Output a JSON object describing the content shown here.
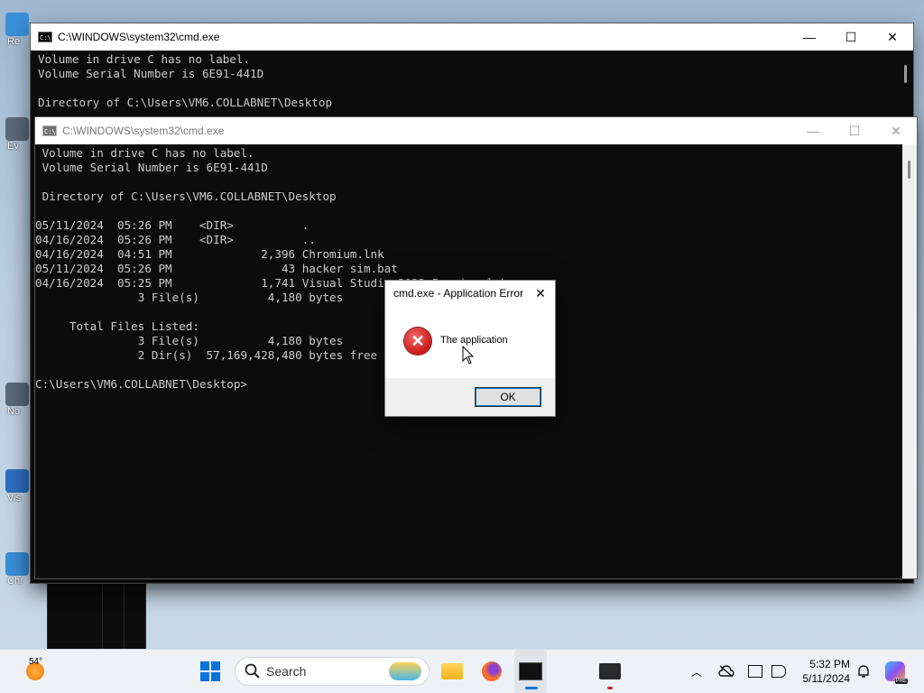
{
  "desktop": {
    "icons": [
      "Re",
      "Ev",
      "No",
      "Vis",
      "Chr"
    ]
  },
  "cmd_back": {
    "title": "C:\\WINDOWS\\system32\\cmd.exe",
    "lines": "Volume in drive C has no label.\nVolume Serial Number is 6E91-441D\n\nDirectory of C:\\Users\\VM6.COLLABNET\\Desktop"
  },
  "cmd_front": {
    "title": "C:\\WINDOWS\\system32\\cmd.exe",
    "lines": " Volume in drive C has no label.\n Volume Serial Number is 6E91-441D\n\n Directory of C:\\Users\\VM6.COLLABNET\\Desktop\n\n05/11/2024  05:26 PM    <DIR>          .\n04/16/2024  05:26 PM    <DIR>          ..\n04/16/2024  04:51 PM             2,396 Chromium.lnk\n05/11/2024  05:26 PM                43 hacker sim.bat\n04/16/2024  05:25 PM             1,741 Visual Studio 2022 Preview.lnk\n               3 File(s)          4,180 bytes\n\n     Total Files Listed:\n               3 File(s)          4,180 bytes\n               2 Dir(s)  57,169,428,480 bytes free\n\nC:\\Users\\VM6.COLLABNET\\Desktop>"
  },
  "window_controls": {
    "minimize": "—",
    "maximize": "☐",
    "close": "✕"
  },
  "dialog": {
    "title": "cmd.exe - Application Error",
    "close": "✕",
    "message": "The application",
    "ok_label": "OK",
    "error_glyph": "✕"
  },
  "taskbar": {
    "weather_temp": "54°",
    "search_label": "Search",
    "time": "5:32 PM",
    "date": "5/11/2024",
    "copilot_badge": "PRE"
  }
}
